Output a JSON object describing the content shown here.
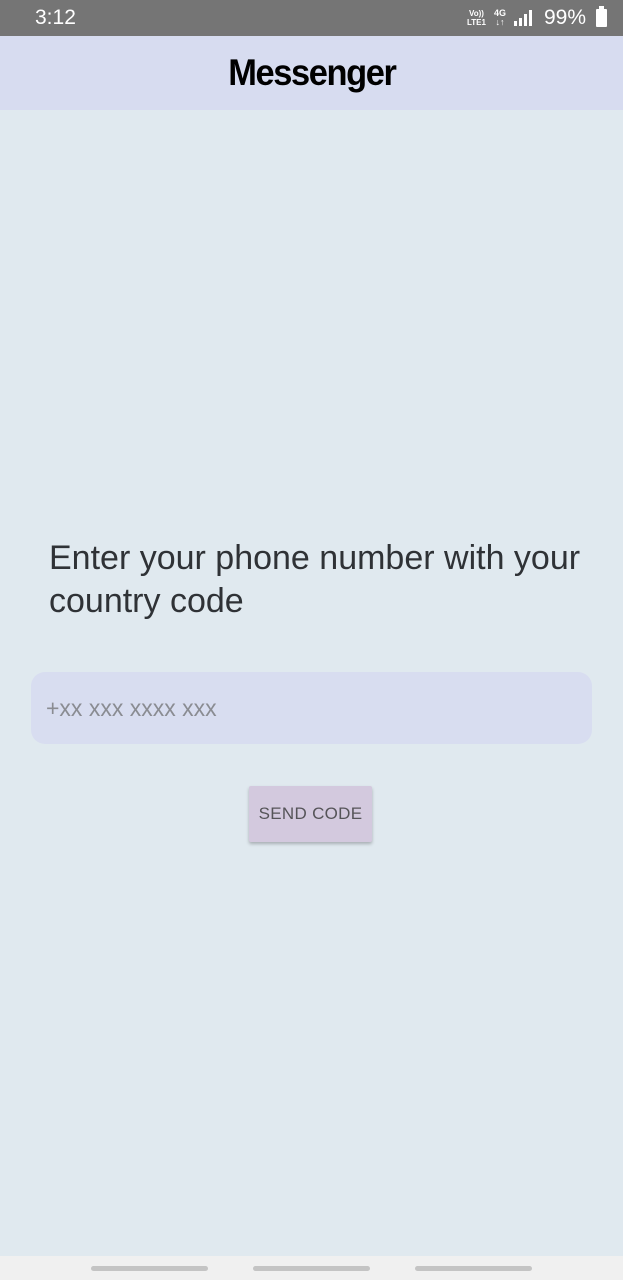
{
  "status_bar": {
    "time": "3:12",
    "volte_top": "Vo))",
    "volte_bottom": "LTE1",
    "network": "4G",
    "network_arrows": "↓↑",
    "battery": "99%"
  },
  "app_bar": {
    "title": "Messenger"
  },
  "main": {
    "prompt": "Enter your phone number with your country code",
    "phone_placeholder": "+xx xxx xxxx xxx",
    "send_button": "SEND CODE"
  },
  "colors": {
    "status_bar": "#757575",
    "app_bar": "#d7dcf0",
    "background": "#e0e9ef",
    "input_fill": "#d8ddf0",
    "button_fill": "#d3c9de"
  },
  "icons": [
    "signal-icon",
    "battery-icon",
    "nav-recent-icon",
    "nav-home-icon",
    "nav-back-icon"
  ]
}
